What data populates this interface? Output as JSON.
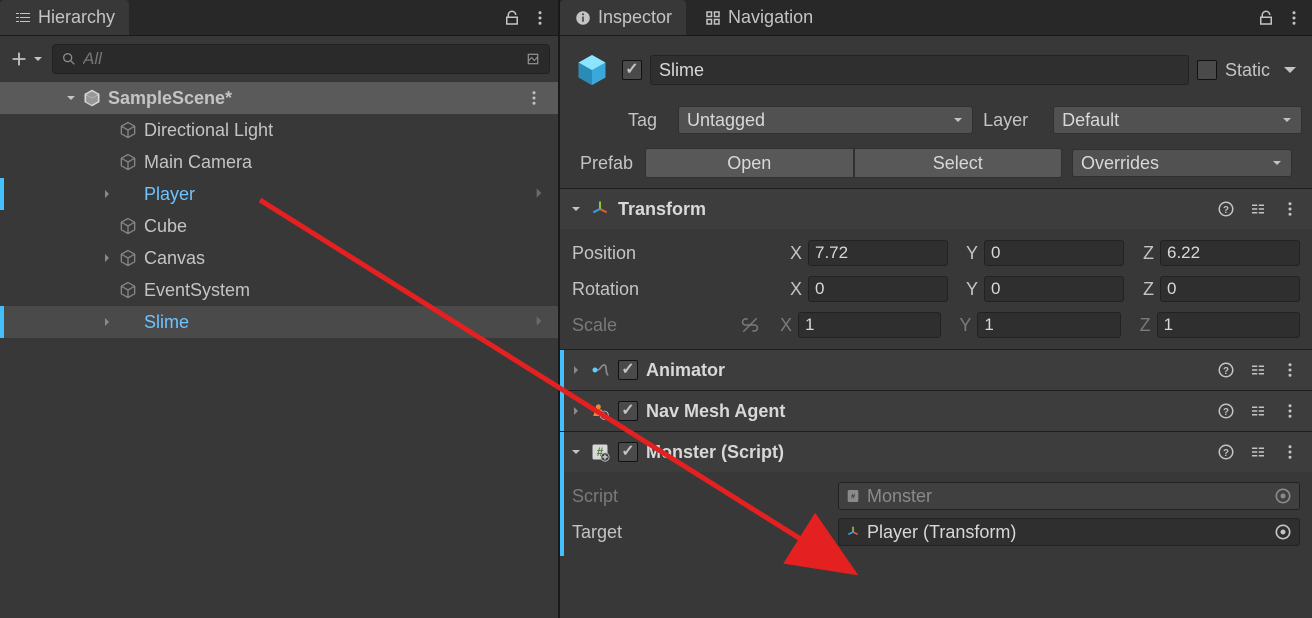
{
  "hierarchy": {
    "tab_title": "Hierarchy",
    "search_placeholder": "All",
    "scene": "SampleScene*",
    "items": [
      {
        "label": "Directional Light"
      },
      {
        "label": "Main Camera"
      },
      {
        "label": "Player"
      },
      {
        "label": "Cube"
      },
      {
        "label": "Canvas"
      },
      {
        "label": "EventSystem"
      },
      {
        "label": "Slime"
      }
    ]
  },
  "inspector": {
    "tab_title": "Inspector",
    "nav_tab": "Navigation",
    "object_name": "Slime",
    "static_label": "Static",
    "tag_label": "Tag",
    "tag_value": "Untagged",
    "layer_label": "Layer",
    "layer_value": "Default",
    "prefab_label": "Prefab",
    "open_btn": "Open",
    "select_btn": "Select",
    "overrides_btn": "Overrides",
    "transform": {
      "title": "Transform",
      "position_label": "Position",
      "rotation_label": "Rotation",
      "scale_label": "Scale",
      "pos": {
        "x": "7.72",
        "y": "0",
        "z": "6.22"
      },
      "rot": {
        "x": "0",
        "y": "0",
        "z": "0"
      },
      "scl": {
        "x": "1",
        "y": "1",
        "z": "1"
      }
    },
    "animator_title": "Animator",
    "navmesh_title": "Nav Mesh Agent",
    "monster": {
      "title": "Monster (Script)",
      "script_label": "Script",
      "script_value": "Monster",
      "target_label": "Target",
      "target_value": "Player (Transform)"
    }
  },
  "axes": {
    "x": "X",
    "y": "Y",
    "z": "Z"
  }
}
